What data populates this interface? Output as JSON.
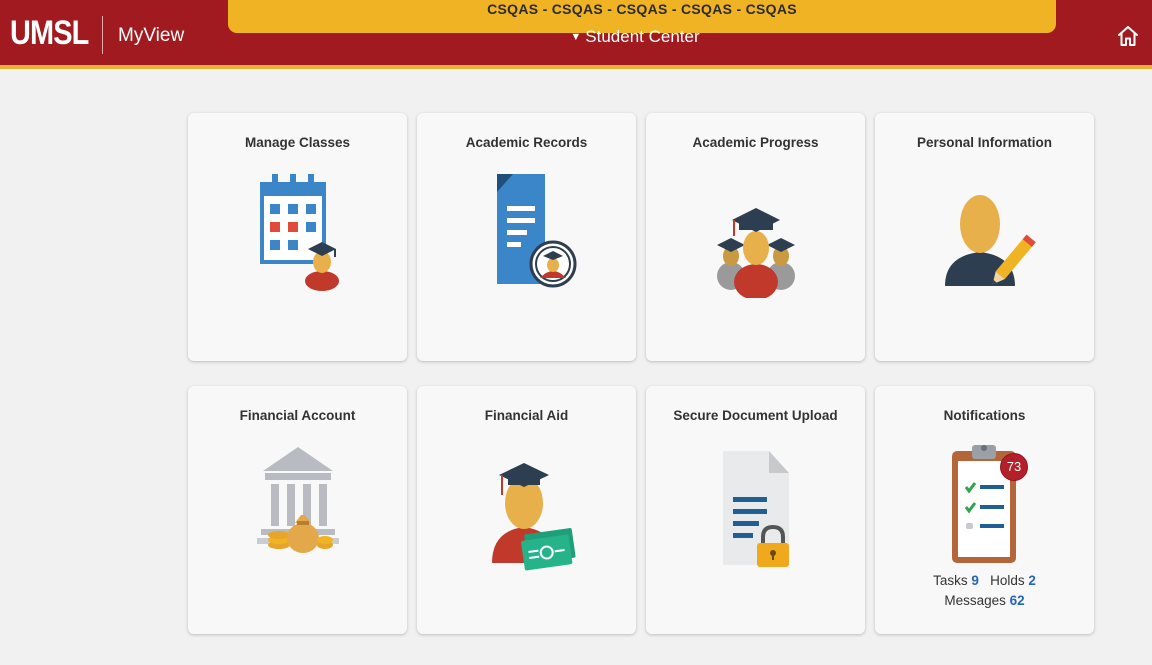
{
  "header": {
    "logo": "UMSL",
    "app_name": "MyView",
    "env_banner": "CSQAS - CSQAS - CSQAS - CSQAS - CSQAS",
    "page_title": "Student Center",
    "home_icon": "home-icon"
  },
  "tiles": [
    {
      "title": "Manage Classes",
      "icon": "calendar-student-icon"
    },
    {
      "title": "Academic Records",
      "icon": "document-student-icon"
    },
    {
      "title": "Academic Progress",
      "icon": "graduates-icon"
    },
    {
      "title": "Personal Information",
      "icon": "person-pencil-icon"
    },
    {
      "title": "Financial Account",
      "icon": "bank-money-icon"
    },
    {
      "title": "Financial Aid",
      "icon": "graduate-money-icon"
    },
    {
      "title": "Secure Document Upload",
      "icon": "document-lock-icon"
    },
    {
      "title": "Notifications",
      "icon": "clipboard-checklist-icon"
    }
  ],
  "notifications": {
    "badge": "73",
    "tasks_label": "Tasks",
    "tasks_count": "9",
    "holds_label": "Holds",
    "holds_count": "2",
    "messages_label": "Messages",
    "messages_count": "62"
  },
  "colors": {
    "header_bg": "#a01a1f",
    "accent_gold": "#f0b323",
    "link_blue": "#2466b8",
    "badge_red": "#b3202a"
  }
}
